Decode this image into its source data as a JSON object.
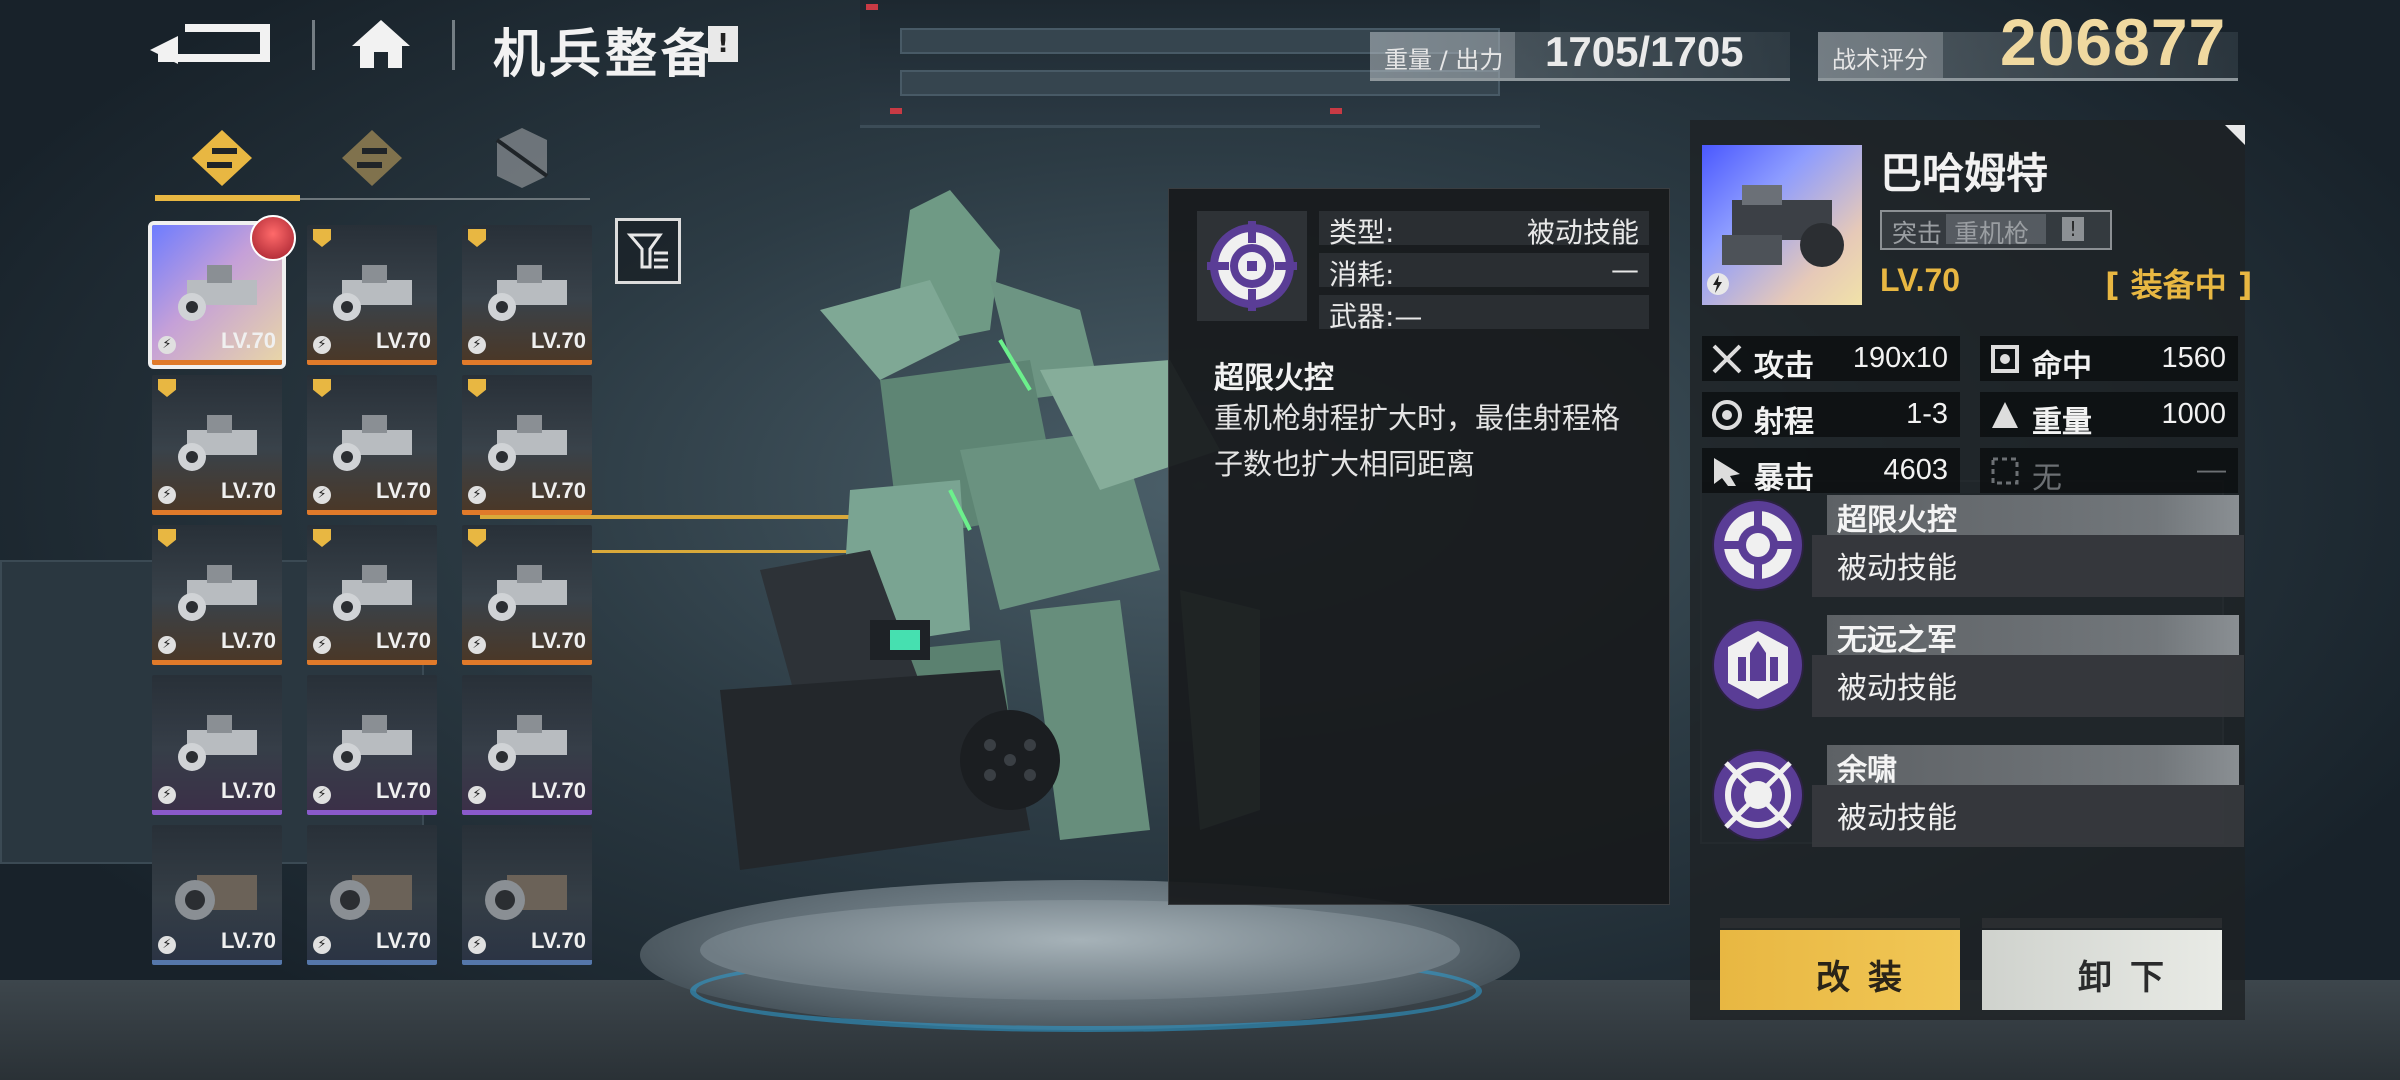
{
  "header": {
    "title": "机兵整备",
    "info_badge": "!",
    "weight_label": "重量 / 出力",
    "weight_value": "1705/1705",
    "score_label": "战术评分",
    "score_value": "206877"
  },
  "inventory": {
    "tabs": [
      "weapon-tab",
      "module-tab",
      "part-tab"
    ],
    "items": [
      {
        "lv": "LV.70",
        "rarity": "orange",
        "selected": true
      },
      {
        "lv": "LV.70",
        "rarity": "orange"
      },
      {
        "lv": "LV.70",
        "rarity": "orange"
      },
      {
        "lv": "LV.70",
        "rarity": "orange"
      },
      {
        "lv": "LV.70",
        "rarity": "orange"
      },
      {
        "lv": "LV.70",
        "rarity": "orange"
      },
      {
        "lv": "LV.70",
        "rarity": "orange"
      },
      {
        "lv": "LV.70",
        "rarity": "orange"
      },
      {
        "lv": "LV.70",
        "rarity": "orange"
      },
      {
        "lv": "LV.70",
        "rarity": "purple"
      },
      {
        "lv": "LV.70",
        "rarity": "purple"
      },
      {
        "lv": "LV.70",
        "rarity": "purple"
      },
      {
        "lv": "LV.70",
        "rarity": "blue"
      },
      {
        "lv": "LV.70",
        "rarity": "blue"
      },
      {
        "lv": "LV.70",
        "rarity": "blue"
      }
    ]
  },
  "tooltip": {
    "type_label": "类型:",
    "type_value": "被动技能",
    "cost_label": "消耗:",
    "cost_value": "—",
    "weapon_label": "武器:—",
    "skill_name": "超限火控",
    "description": "重机枪射程扩大时，最佳射程格子数也扩大相同距离"
  },
  "weapon": {
    "name": "巴哈姆特",
    "tag1": "突击",
    "tag2": "重机枪",
    "tag_badge": "!",
    "level": "LV.70",
    "status": "[ 装备中 ]",
    "attributes": [
      {
        "label": "攻击",
        "value": "190x10",
        "icon": "attack-icon"
      },
      {
        "label": "命中",
        "value": "1560",
        "icon": "accuracy-icon"
      },
      {
        "label": "射程",
        "value": "1-3",
        "icon": "range-icon"
      },
      {
        "label": "重量",
        "value": "1000",
        "icon": "weight-icon"
      },
      {
        "label": "暴击",
        "value": "4603",
        "icon": "critical-icon"
      },
      {
        "label": "无",
        "value": "—",
        "icon": "empty-slot-icon"
      }
    ],
    "skills": [
      {
        "name": "超限火控",
        "type": "被动技能"
      },
      {
        "name": "无远之军",
        "type": "被动技能"
      },
      {
        "name": "余啸",
        "type": "被动技能"
      }
    ]
  },
  "actions": {
    "modify": "改装",
    "unequip": "卸下"
  },
  "colors": {
    "accent": "#e8b742",
    "orange_rarity": "#e07a2a",
    "purple_rarity": "#8a5acb",
    "blue_rarity": "#5577aa"
  }
}
